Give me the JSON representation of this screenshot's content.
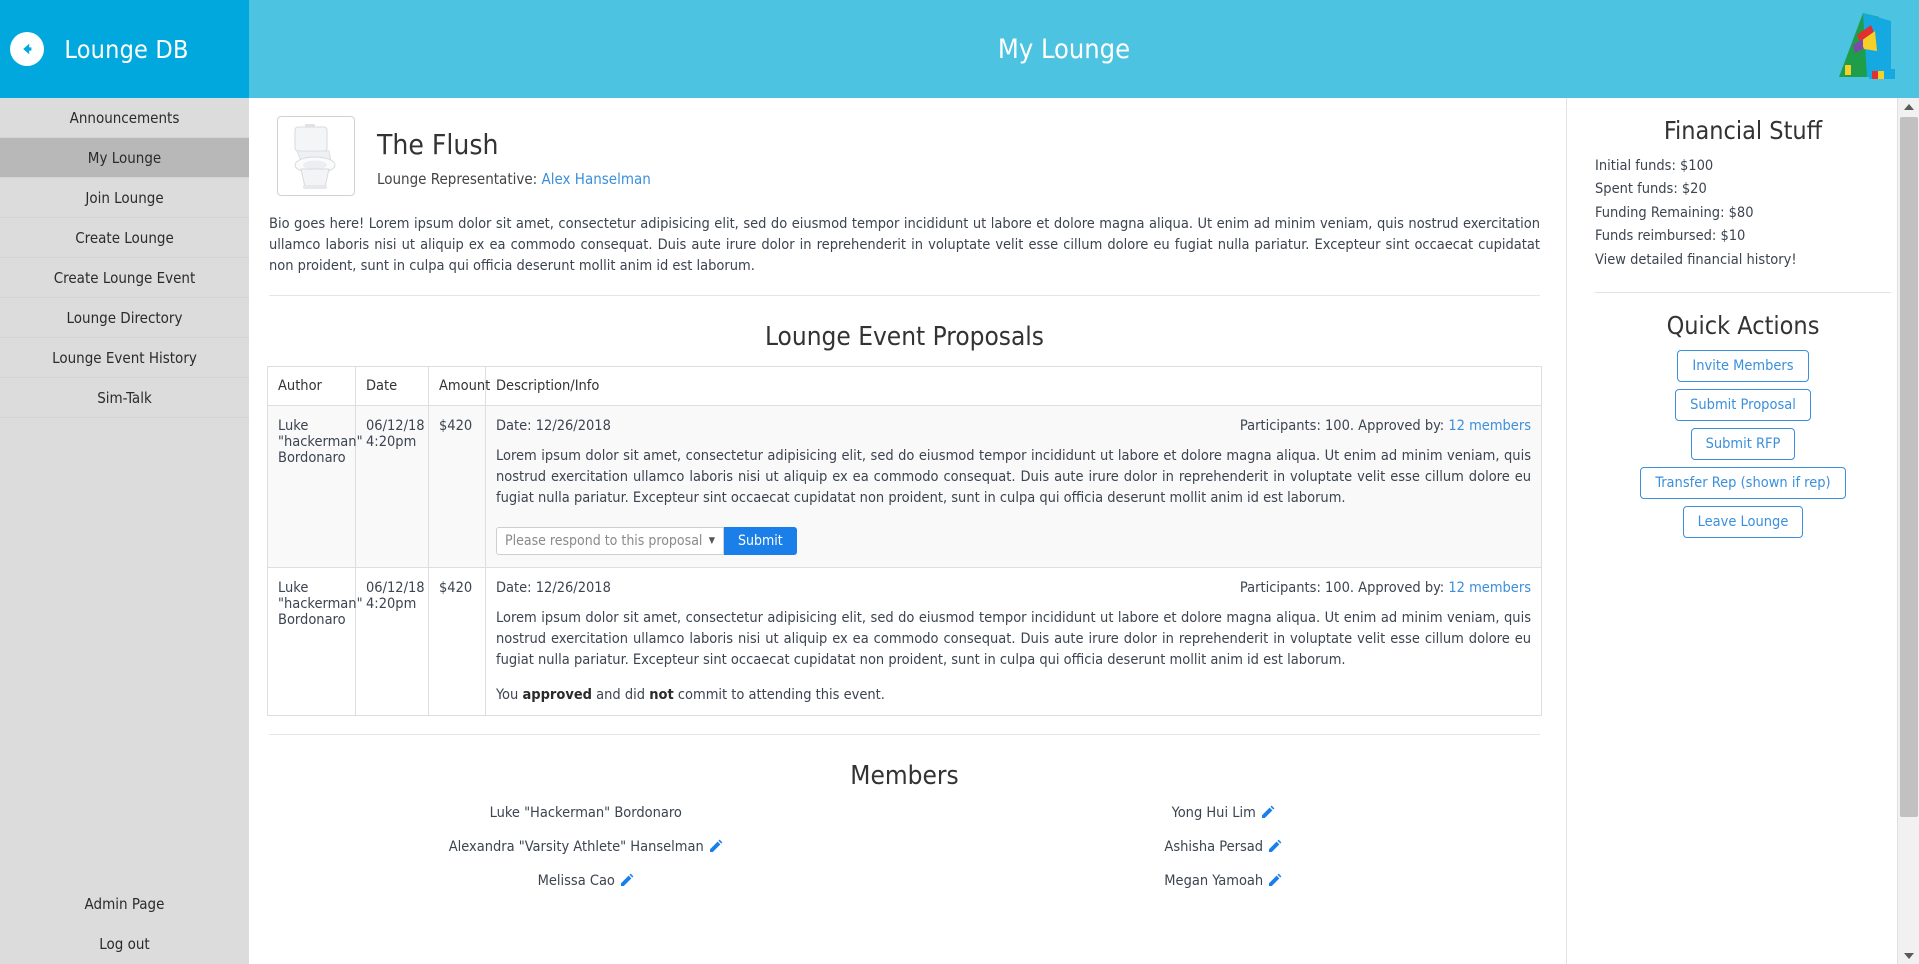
{
  "sidebar": {
    "brand": "Lounge DB",
    "back_icon": "back-arrow-icon",
    "items": [
      {
        "label": "Announcements",
        "active": false
      },
      {
        "label": "My Lounge",
        "active": true
      },
      {
        "label": "Join Lounge",
        "active": false
      },
      {
        "label": "Create Lounge",
        "active": false
      },
      {
        "label": "Create Lounge Event",
        "active": false
      },
      {
        "label": "Lounge Directory",
        "active": false
      },
      {
        "label": "Lounge Event History",
        "active": false
      },
      {
        "label": "Sim-Talk",
        "active": false
      }
    ],
    "bottom_items": [
      {
        "label": "Admin Page"
      },
      {
        "label": "Log out"
      }
    ]
  },
  "header": {
    "title": "My Lounge",
    "logo_icon": "app-logo-icon"
  },
  "lounge": {
    "thumbnail_icon": "toilet-photo",
    "name": "The Flush",
    "rep_label": "Lounge Representative:",
    "rep_name": "Alex Hanselman",
    "bio": "Bio goes here! Lorem ipsum dolor sit amet, consectetur adipisicing elit, sed do eiusmod tempor incididunt ut labore et dolore magna aliqua. Ut enim ad minim veniam, quis nostrud exercitation ullamco laboris nisi ut aliquip ex ea commodo consequat. Duis aute irure dolor in reprehenderit in voluptate velit esse cillum dolore eu fugiat nulla pariatur. Excepteur sint occaecat cupidatat non proident, sunt in culpa qui officia deserunt mollit anim id est laborum."
  },
  "proposals": {
    "title": "Lounge Event Proposals",
    "columns": [
      "Author",
      "Date",
      "Amount",
      "Description/Info"
    ],
    "rows": [
      {
        "author": "Luke \"hackerman\" Bordonaro",
        "date": "06/12/18 4:20pm",
        "amount": "$420",
        "event_date": "Date: 12/26/2018",
        "participants": "Participants: 100. Approved by:",
        "approved_link": "12 members",
        "body": "Lorem ipsum dolor sit amet, consectetur adipisicing elit, sed do eiusmod tempor incididunt ut labore et dolore magna aliqua. Ut enim ad minim veniam, quis nostrud exercitation ullamco laboris nisi ut aliquip ex ea commodo consequat. Duis aute irure dolor in reprehenderit in voluptate velit esse cillum dolore eu fugiat nulla pariatur. Excepteur sint occaecat cupidatat non proident, sunt in culpa qui officia deserunt mollit anim id est laborum.",
        "has_respond": true,
        "select_value": "Please respond to this proposal",
        "select_caret": "▼",
        "submit_label": "Submit"
      },
      {
        "author": "Luke \"hackerman\" Bordonaro",
        "date": "06/12/18 4:20pm",
        "amount": "$420",
        "event_date": "Date: 12/26/2018",
        "participants": "Participants: 100. Approved by:",
        "approved_link": "12 members",
        "body": "Lorem ipsum dolor sit amet, consectetur adipisicing elit, sed do eiusmod tempor incididunt ut labore et dolore magna aliqua. Ut enim ad minim veniam, quis nostrud exercitation ullamco laboris nisi ut aliquip ex ea commodo consequat. Duis aute irure dolor in reprehenderit in voluptate velit esse cillum dolore eu fugiat nulla pariatur. Excepteur sint occaecat cupidatat non proident, sunt in culpa qui officia deserunt mollit anim id est laborum.",
        "has_respond": false,
        "status_pre": "You ",
        "status_bold1": "approved",
        "status_mid": " and did ",
        "status_bold2": "not",
        "status_post": " commit to attending this event."
      }
    ]
  },
  "members": {
    "title": "Members",
    "list": [
      {
        "name": "Luke \"Hackerman\" Bordonaro",
        "editable": false
      },
      {
        "name": "Yong Hui Lim",
        "editable": true
      },
      {
        "name": "Alexandra \"Varsity Athlete\" Hanselman",
        "editable": true
      },
      {
        "name": "Ashisha Persad",
        "editable": true
      },
      {
        "name": "Melissa Cao",
        "editable": true
      },
      {
        "name": "Megan Yamoah",
        "editable": true
      }
    ]
  },
  "financial": {
    "title": "Financial Stuff",
    "lines": [
      "Initial funds: $100",
      "Spent funds: $20",
      "Funding Remaining: $80",
      "Funds reimbursed: $10"
    ],
    "history_link": "View detailed financial history!"
  },
  "quick_actions": {
    "title": "Quick Actions",
    "buttons": [
      "Invite Members",
      "Submit Proposal",
      "Submit RFP",
      "Transfer Rep (shown if rep)",
      "Leave Lounge"
    ]
  },
  "colors": {
    "sidebar_header": "#00a8dd",
    "topbar": "#4cc3e0",
    "sidebar_bg": "#dcdcdc",
    "sidebar_active": "#b8b8b8",
    "link": "#3b8fdc",
    "submit_button": "#1a7fe8"
  },
  "scrollbar": {
    "up_icon": "scroll-up-arrow-icon",
    "down_icon": "scroll-down-arrow-icon"
  }
}
